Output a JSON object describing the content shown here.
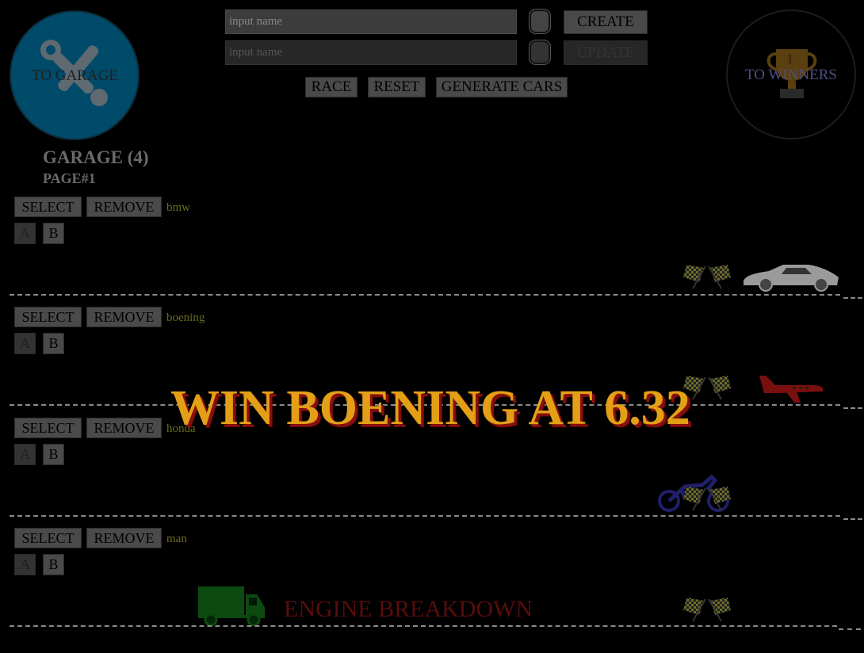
{
  "nav": {
    "garage_label": "TO GARAGE",
    "winners_label": "TO WINNERS",
    "trophy_number": "1"
  },
  "form": {
    "create_placeholder": "input name",
    "update_placeholder": "input name",
    "create_label": "CREATE",
    "update_label": "UPDATE",
    "race_label": "RACE",
    "reset_label": "RESET",
    "generate_label": "GENERATE CARS"
  },
  "garage": {
    "title": "GARAGE (4)",
    "page": "PAGE#1"
  },
  "cars": [
    {
      "name": "bmw",
      "select": "SELECT",
      "remove": "REMOVE",
      "a": "A",
      "b": "B",
      "color": "#9a9a9a"
    },
    {
      "name": "boening",
      "select": "SELECT",
      "remove": "REMOVE",
      "a": "A",
      "b": "B",
      "color": "#7a0f10"
    },
    {
      "name": "honda",
      "select": "SELECT",
      "remove": "REMOVE",
      "a": "A",
      "b": "B",
      "color": "#1f1f6a"
    },
    {
      "name": "man",
      "select": "SELECT",
      "remove": "REMOVE",
      "a": "A",
      "b": "B",
      "color": "#0d4a12"
    }
  ],
  "race": {
    "winner_message": "WIN BOENING AT 6.32",
    "breakdown_message": "ENGINE BREAKDOWN"
  },
  "colors": {
    "background": "#000000",
    "garage_circle": "#004a6a",
    "banner_text": "#e3a017",
    "banner_shadow": "#8a0f0f",
    "car_name": "#6b6b22"
  }
}
